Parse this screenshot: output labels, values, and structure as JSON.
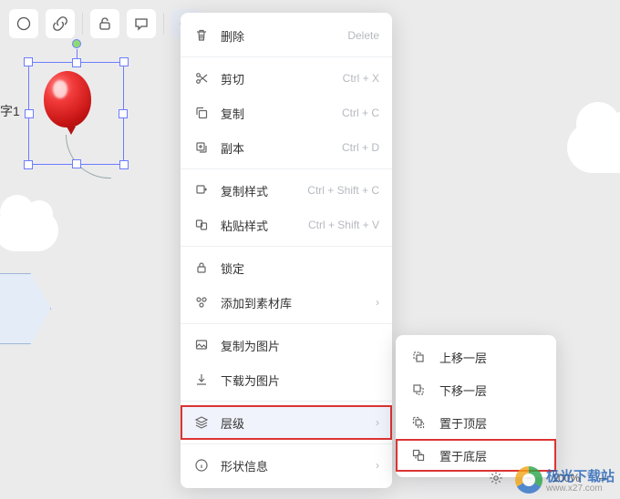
{
  "canvas": {
    "text_label": "字1"
  },
  "toolbar": {
    "icons": [
      "circle-icon",
      "chain-icon",
      "lock-open-icon",
      "comment-icon",
      "more-icon"
    ]
  },
  "menu": {
    "delete": {
      "label": "删除",
      "shortcut": "Delete"
    },
    "cut": {
      "label": "剪切",
      "shortcut": "Ctrl + X"
    },
    "copy": {
      "label": "复制",
      "shortcut": "Ctrl + C"
    },
    "duplicate": {
      "label": "副本",
      "shortcut": "Ctrl + D"
    },
    "copy_style": {
      "label": "复制样式",
      "shortcut": "Ctrl + Shift + C"
    },
    "paste_style": {
      "label": "粘贴样式",
      "shortcut": "Ctrl + Shift + V"
    },
    "lock": {
      "label": "锁定"
    },
    "add_to_lib": {
      "label": "添加到素材库"
    },
    "copy_as_image": {
      "label": "复制为图片"
    },
    "download_as_image": {
      "label": "下载为图片"
    },
    "layer": {
      "label": "层级"
    },
    "shape_info": {
      "label": "形状信息"
    }
  },
  "layer_submenu": {
    "bring_forward": {
      "label": "上移一层"
    },
    "send_backward": {
      "label": "下移一层"
    },
    "bring_front": {
      "label": "置于顶层"
    },
    "send_back": {
      "label": "置于底层"
    }
  },
  "status": {
    "zoom": "100%"
  },
  "watermark": {
    "name": "极光下载站",
    "url": "www.x27.com"
  }
}
